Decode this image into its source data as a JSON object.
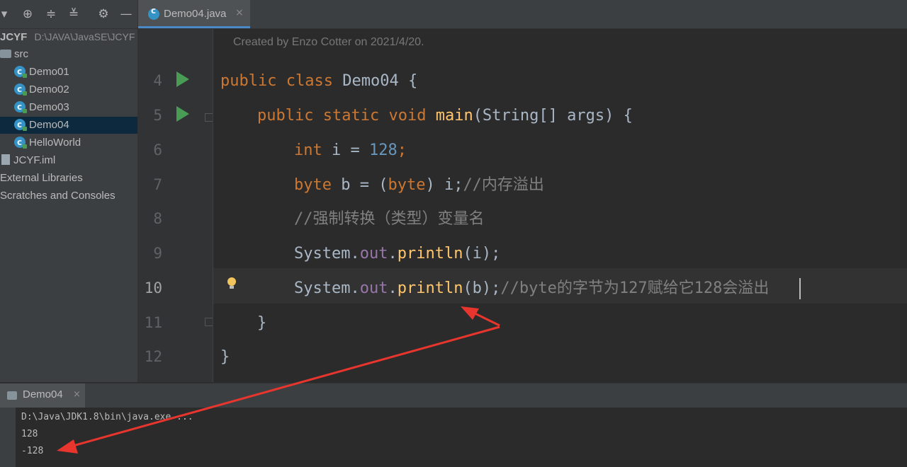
{
  "project": {
    "root_name": "JCYF",
    "root_path": "D:\\JAVA\\JavaSE\\JCYF",
    "src_label": "src",
    "classes": [
      "Demo01",
      "Demo02",
      "Demo03",
      "Demo04",
      "HelloWorld"
    ],
    "selected_class": "Demo04",
    "iml_file": "JCYF.iml",
    "external_libraries": "External Libraries",
    "scratches": "Scratches and Consoles"
  },
  "toolbar_icons": [
    "dropdown-icon",
    "locate-icon",
    "expand-all-icon",
    "collapse-all-icon",
    "gear-icon",
    "minimize-icon"
  ],
  "editor_tab": {
    "label": "Demo04.java",
    "close": "×"
  },
  "editor": {
    "doc_comment": "Created by Enzo Cotter on 2021/4/20.",
    "current_line": 10,
    "lines": [
      {
        "number": "4",
        "tokens": {
          "kw1": "public",
          "kw2": "class",
          "name": "Demo04",
          "brace": "{"
        }
      },
      {
        "number": "5",
        "tokens": {
          "kw1": "public",
          "kw2": "static",
          "kw3": "void",
          "fn": "main",
          "params": "(String[] args)",
          "brace": "{"
        }
      },
      {
        "number": "6",
        "tokens": {
          "type": "int",
          "rest": " i = ",
          "num": "128",
          "end": ";"
        }
      },
      {
        "number": "7",
        "tokens": {
          "type": "byte",
          "rest": " b = (",
          "cast": "byte",
          "rest2": ") i;",
          "comment": "//内存溢出"
        }
      },
      {
        "number": "8",
        "tokens": {
          "comment": "//强制转换（类型）变量名"
        }
      },
      {
        "number": "9",
        "tokens": {
          "cls": "System.",
          "field": "out",
          "dot": ".",
          "fn": "println",
          "rest": "(i);"
        }
      },
      {
        "number": "10",
        "tokens": {
          "cls": "System.",
          "field": "out",
          "dot": ".",
          "fn": "println",
          "rest": "(b);",
          "comment": "//byte的字节为127赋给它128会溢出"
        }
      },
      {
        "number": "11",
        "tokens": {
          "brace": "}"
        }
      },
      {
        "number": "12",
        "tokens": {
          "brace": "}"
        }
      }
    ]
  },
  "run_panel": {
    "tab_label": "Demo04",
    "close": "×",
    "output": [
      "D:\\Java\\JDK1.8\\bin\\java.exe ...",
      "128",
      "-128"
    ]
  },
  "colors": {
    "keyword": "#cc7832",
    "number": "#6897bb",
    "comment": "#808080",
    "annotation_arrow": "#e8352e",
    "run_icon": "#499c54",
    "selection": "#0d293e"
  }
}
